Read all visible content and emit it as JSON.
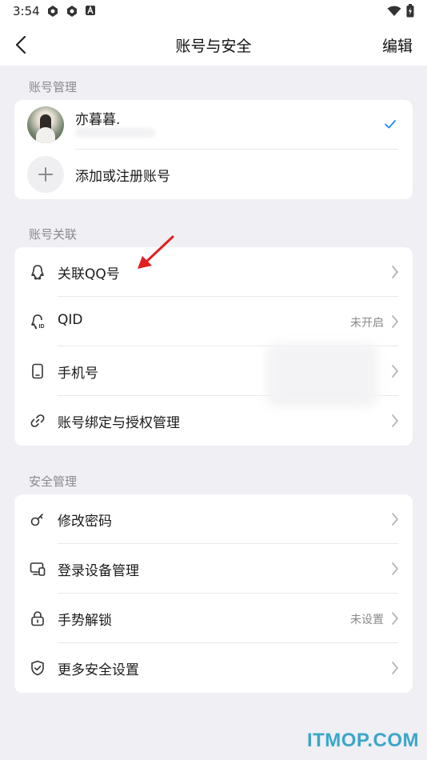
{
  "status_bar": {
    "time": "3:54"
  },
  "nav": {
    "title": "账号与安全",
    "edit_label": "编辑"
  },
  "account_management": {
    "header": "账号管理",
    "current_account": {
      "name": "亦暮暮."
    },
    "add_account_label": "添加或注册账号"
  },
  "account_linking": {
    "header": "账号关联",
    "items": [
      {
        "label": "关联QQ号",
        "icon": "qq-link-icon",
        "value": ""
      },
      {
        "label": "QID",
        "icon": "qid-icon",
        "value": "未开启"
      },
      {
        "label": "手机号",
        "icon": "phone-icon",
        "value": ""
      },
      {
        "label": "账号绑定与授权管理",
        "icon": "link-icon",
        "value": ""
      }
    ]
  },
  "security_management": {
    "header": "安全管理",
    "items": [
      {
        "label": "修改密码",
        "icon": "key-icon",
        "value": ""
      },
      {
        "label": "登录设备管理",
        "icon": "devices-icon",
        "value": ""
      },
      {
        "label": "手势解锁",
        "icon": "lock-icon",
        "value": "未设置"
      },
      {
        "label": "更多安全设置",
        "icon": "shield-icon",
        "value": ""
      }
    ]
  },
  "watermark": "ITMOP.COM",
  "colors": {
    "accent": "#1a8cff",
    "background": "#efeff4",
    "annotation_arrow": "#e02020",
    "watermark": "#3aa7c9"
  }
}
